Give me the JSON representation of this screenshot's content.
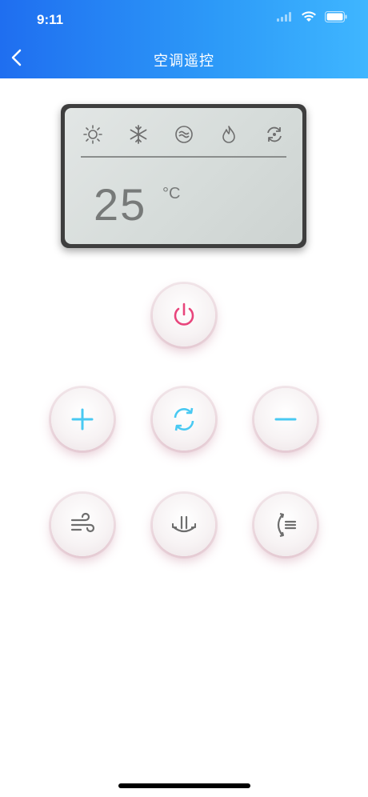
{
  "status_bar": {
    "time": "9:11"
  },
  "header": {
    "title": "空调遥控"
  },
  "display": {
    "temperature": "25",
    "unit": "°C"
  },
  "icons": {
    "lcd_modes": [
      "sun-icon",
      "snowflake-icon",
      "dehumidify-icon",
      "flame-icon",
      "auto-cycle-icon"
    ]
  },
  "colors": {
    "header_start": "#1f6ef0",
    "header_end": "#3fb6ff",
    "power": "#e8457c",
    "accent": "#49c9f2",
    "icon_gray": "#6e6e6e"
  }
}
